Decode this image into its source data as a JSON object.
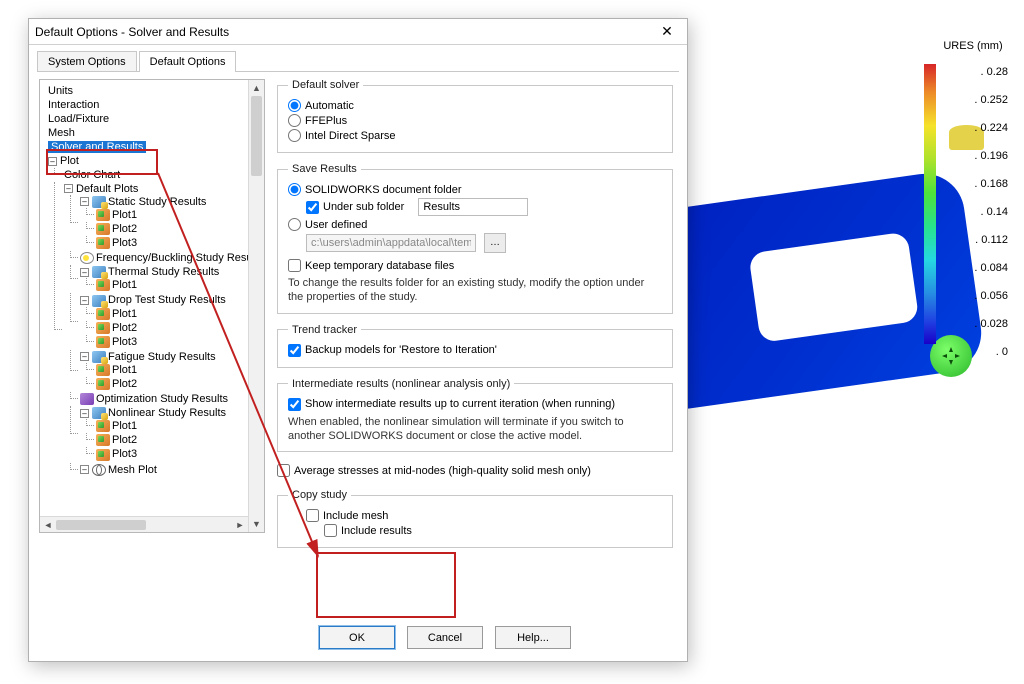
{
  "dialog": {
    "title": "Default Options - Solver and Results",
    "tabs": {
      "system": "System Options",
      "default": "Default Options"
    }
  },
  "tree": {
    "units": "Units",
    "interaction": "Interaction",
    "load_fixture": "Load/Fixture",
    "mesh": "Mesh",
    "solver_results": "Solver and Results",
    "plot": "Plot",
    "color_chart": "Color Chart",
    "default_plots": "Default Plots",
    "static": "Static Study Results",
    "plot1": "Plot1",
    "plot2": "Plot2",
    "plot3": "Plot3",
    "freq": "Frequency/Buckling Study Results",
    "thermal": "Thermal Study Results",
    "drop": "Drop Test Study Results",
    "fatigue": "Fatigue Study Results",
    "optimization": "Optimization Study Results",
    "nonlinear": "Nonlinear Study Results",
    "mesh_plot": "Mesh Plot"
  },
  "solver": {
    "legend": "Default solver",
    "automatic": "Automatic",
    "ffeplus": "FFEPlus",
    "intel": "Intel Direct Sparse"
  },
  "save": {
    "legend": "Save Results",
    "sw_folder": "SOLIDWORKS document folder",
    "under_sub": "Under sub folder",
    "sub_value": "Results",
    "user_defined": "User defined",
    "user_path": "c:\\users\\admin\\appdata\\local\\temp",
    "keep_temp": "Keep temporary database files",
    "note": "To change the results folder for an existing study, modify the option under the properties of the study."
  },
  "trend": {
    "legend": "Trend tracker",
    "backup": "Backup models for 'Restore to Iteration'"
  },
  "inter": {
    "legend": "Intermediate results (nonlinear analysis only)",
    "show": "Show intermediate results up to current iteration (when running)",
    "note": "When enabled, the nonlinear simulation will terminate if you switch to another SOLIDWORKS document or close the active model."
  },
  "avg": "Average stresses at mid-nodes (high-quality solid mesh only)",
  "copy": {
    "legend": "Copy study",
    "mesh": "Include mesh",
    "results": "Include results"
  },
  "buttons": {
    "ok": "OK",
    "cancel": "Cancel",
    "help": "Help..."
  },
  "legend_title": "URES (mm)",
  "chart_data": {
    "type": "colorbar",
    "title": "URES (mm)",
    "ylim": [
      0.0,
      0.28
    ],
    "ticks": [
      0.28,
      0.252,
      0.224,
      0.196,
      0.168,
      0.14,
      0.112,
      0.084,
      0.056,
      0.028,
      0.0
    ],
    "colormap": "rainbow (red=max, blue=min)"
  }
}
